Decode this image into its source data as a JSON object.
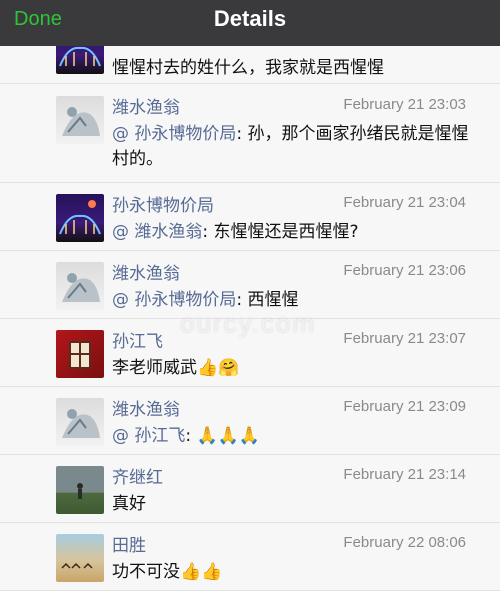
{
  "navbar": {
    "done_label": "Done",
    "title": "Details"
  },
  "watermark": "ourcy.com",
  "comments": [
    {
      "author": "",
      "time": "",
      "text": "惺惺村去的姓什么，我家就是西惺惺",
      "avatar": "museum"
    },
    {
      "author": "潍水渔翁",
      "time": "February 21 23:03",
      "mention": "@ 孙永博物价局",
      "text": ": 孙，那个画家孙绪民就是惺惺村的。",
      "avatar": "fisher"
    },
    {
      "author": "孙永博物价局",
      "time": "February 21 23:04",
      "mention": "@ 潍水渔翁",
      "text": ": 东惺惺还是西惺惺?",
      "avatar": "museum"
    },
    {
      "author": "潍水渔翁",
      "time": "February 21 23:06",
      "mention": "@ 孙永博物价局",
      "text": ": 西惺惺",
      "avatar": "fisher"
    },
    {
      "author": "孙江飞",
      "time": "February 21 23:07",
      "text": "李老师威武",
      "emojis": "👍🤗",
      "avatar": "sun"
    },
    {
      "author": "潍水渔翁",
      "time": "February 21 23:09",
      "mention": "@ 孙江飞",
      "text": ": ",
      "emojis": "🙏🙏🙏",
      "avatar": "fisher"
    },
    {
      "author": "齐继红",
      "time": "February 21 23:14",
      "text": "真好",
      "avatar": "qi"
    },
    {
      "author": "田胜",
      "time": "February 22 08:06",
      "text": "功不可没",
      "emojis": "👍👍",
      "avatar": "tian"
    }
  ]
}
